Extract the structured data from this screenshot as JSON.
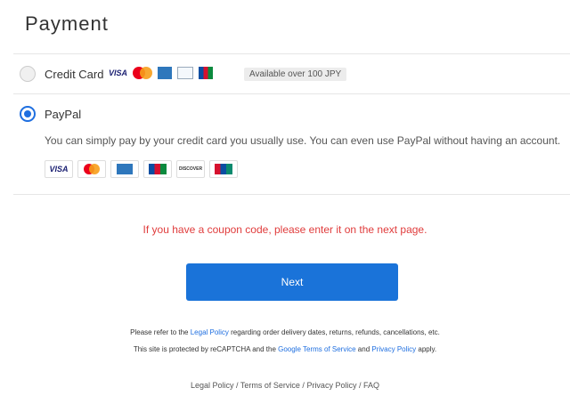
{
  "page": {
    "title": "Payment"
  },
  "options": {
    "credit_card": {
      "label": "Credit Card",
      "badge": "Available over 100 JPY",
      "selected": false
    },
    "paypal": {
      "label": "PayPal",
      "selected": true,
      "description": "You can simply pay by your credit card you usually use. You can even use PayPal without having an account."
    }
  },
  "coupon_notice": "If you have a coupon code, please enter it on the next page.",
  "next_button": "Next",
  "legal": {
    "line1_prefix": "Please refer to the ",
    "line1_link": "Legal Policy",
    "line1_suffix": " regarding order delivery dates, returns, refunds, cancellations, etc.",
    "line2_prefix": "This site is protected by reCAPTCHA and the ",
    "line2_link1": "Google Terms of Service",
    "line2_mid": " and ",
    "line2_link2": "Privacy Policy",
    "line2_suffix": " apply."
  },
  "footer": {
    "legal_policy": "Legal Policy",
    "terms": "Terms of Service",
    "privacy": "Privacy Policy",
    "faq": "FAQ",
    "sep": " / "
  },
  "card_logos": {
    "visa": "VISA",
    "jcb": "JCB",
    "discover": "DISCOVER",
    "unionpay": "UnionPay"
  },
  "colors": {
    "accent": "#1a73d9",
    "notice": "#e03c3c"
  }
}
